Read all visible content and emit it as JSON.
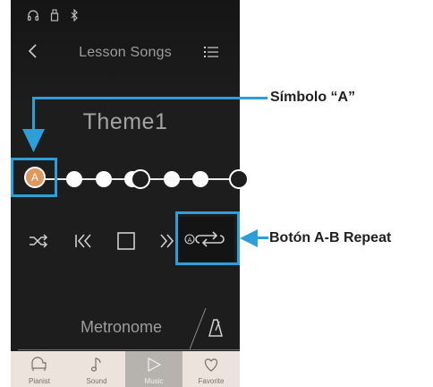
{
  "status_bar": {
    "icons": [
      "headphones-icon",
      "usb-icon",
      "bluetooth-icon"
    ]
  },
  "header": {
    "title": "Lesson Songs",
    "back_icon": "chevron-left-icon",
    "list_icon": "list-icon"
  },
  "song": {
    "title": "Theme1"
  },
  "track": {
    "a_marker_label": "A"
  },
  "controls": {
    "items": [
      "shuffle-icon",
      "rewind-icon",
      "stop-icon",
      "fast-forward-icon",
      "ab-repeat-icon"
    ]
  },
  "metronome": {
    "label": "Metronome",
    "icon": "metronome-icon"
  },
  "tabs": [
    {
      "label": "Pianist",
      "icon": "piano-icon"
    },
    {
      "label": "Sound",
      "icon": "note-icon"
    },
    {
      "label": "Music",
      "icon": "play-icon",
      "active": true
    },
    {
      "label": "Favorite",
      "icon": "heart-icon"
    }
  ],
  "annotations": {
    "symbol_a": "Símbolo “A”",
    "ab_button": "Botón A-B Repeat"
  },
  "colors": {
    "accent": "#2c9fd8",
    "marker": "#e0975e",
    "tab_bg": "#ece3dc",
    "tab_active_bg": "#b6b2ae",
    "screen_bg": "#1d1d1d"
  }
}
